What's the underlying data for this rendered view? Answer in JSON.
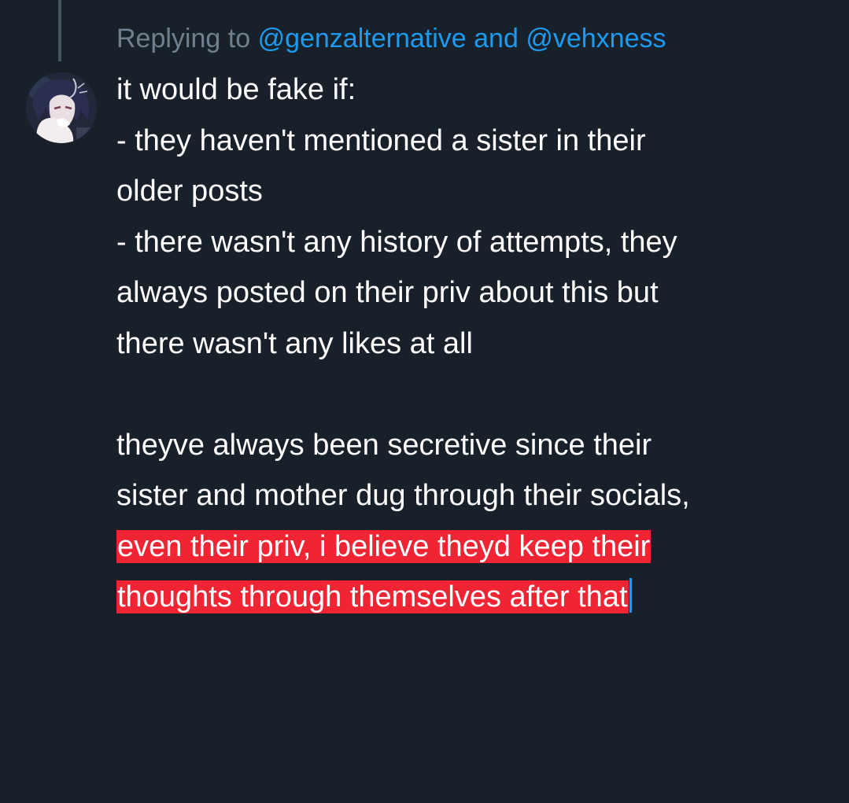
{
  "reply": {
    "prefix": "Replying to",
    "mention_1": "@genzalternative",
    "conjunction": "and",
    "mention_2": "@vehxness"
  },
  "avatar": {
    "icon": "anime-character-avatar"
  },
  "tweet": {
    "lines": [
      "it would be fake if:",
      "- they haven't mentioned a sister in their",
      "older posts",
      "- there wasn't any history of attempts, they",
      "always posted on their priv about this but",
      "there wasn't any likes at all",
      "theyve always been secretive since their",
      "sister and mother dug through their socials,"
    ],
    "highlighted_lines": [
      "even their priv, i believe theyd keep their",
      "thoughts through themselves after that"
    ]
  },
  "colors": {
    "background": "#18202a",
    "muted_text": "#71808e",
    "link": "#1d9bf0",
    "highlight": "#f02433",
    "thread_line": "#465560"
  }
}
